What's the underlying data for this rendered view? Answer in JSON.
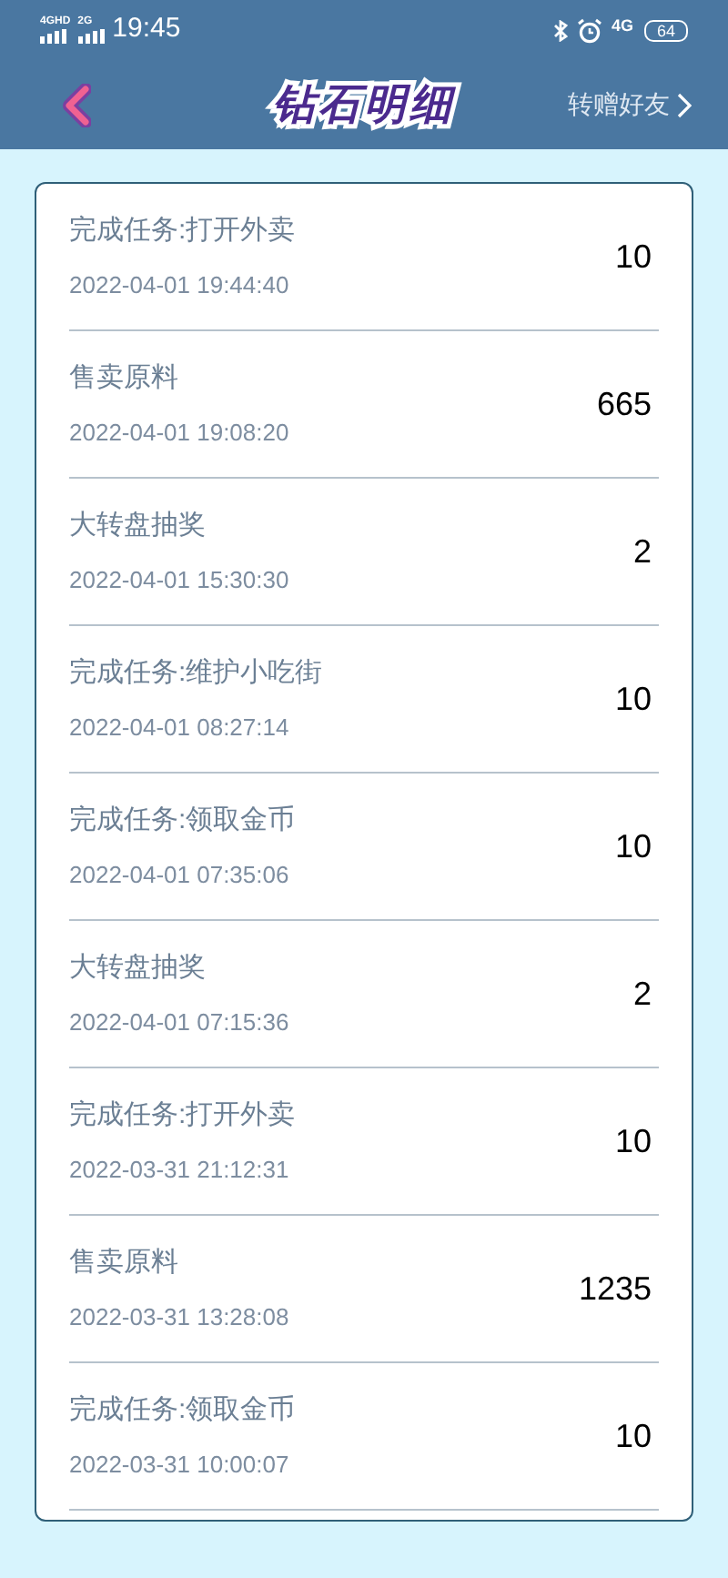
{
  "status_bar": {
    "network_1": "4GHD",
    "network_2": "2G",
    "time": "19:45",
    "network_3": "4G",
    "battery": "64"
  },
  "header": {
    "title": "钻石明细",
    "action": "转赠好友"
  },
  "records": [
    {
      "title": "完成任务:打开外卖",
      "time": "2022-04-01 19:44:40",
      "amount": "10"
    },
    {
      "title": "售卖原料",
      "time": "2022-04-01 19:08:20",
      "amount": "665"
    },
    {
      "title": "大转盘抽奖",
      "time": "2022-04-01 15:30:30",
      "amount": "2"
    },
    {
      "title": "完成任务:维护小吃街",
      "time": "2022-04-01 08:27:14",
      "amount": "10"
    },
    {
      "title": "完成任务:领取金币",
      "time": "2022-04-01 07:35:06",
      "amount": "10"
    },
    {
      "title": "大转盘抽奖",
      "time": "2022-04-01 07:15:36",
      "amount": "2"
    },
    {
      "title": "完成任务:打开外卖",
      "time": "2022-03-31 21:12:31",
      "amount": "10"
    },
    {
      "title": "售卖原料",
      "time": "2022-03-31 13:28:08",
      "amount": "1235"
    },
    {
      "title": "完成任务:领取金币",
      "time": "2022-03-31 10:00:07",
      "amount": "10"
    }
  ]
}
